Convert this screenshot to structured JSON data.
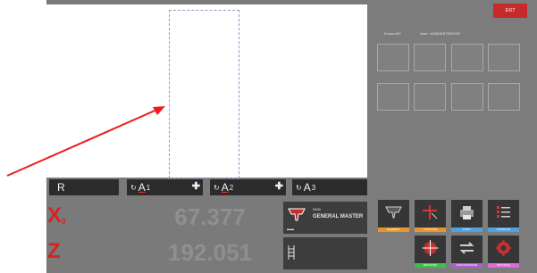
{
  "window": {
    "exit_label": "EXIT"
  },
  "status": {
    "left": "Erowa M2",
    "user": "User: ADMINISTRATOR"
  },
  "command_bar": {
    "r_label": "R",
    "a1": {
      "prefix": "↻",
      "letter": "A",
      "index": "1",
      "action": "✚"
    },
    "a2": {
      "prefix": "↻",
      "letter": "A",
      "index": "2",
      "action": "✚"
    },
    "a3": {
      "prefix": "↻",
      "letter": "A",
      "index": "3"
    }
  },
  "axes": {
    "x": {
      "letter": "X",
      "subscript": "0",
      "value": "67.377"
    },
    "z": {
      "letter": "Z",
      "value": "192.051"
    }
  },
  "tool": {
    "code": "0000",
    "name": "GENERAL MASTER",
    "status": "▬▬"
  },
  "functions": [
    {
      "label": "ELEMENT",
      "color": "#e8962b",
      "icon": "tool-holder-icon"
    },
    {
      "label": "FUNCTION",
      "color": "#e8962b",
      "icon": "crosshair-arrow-icon"
    },
    {
      "label": "PRINT",
      "color": "#4da3e0",
      "icon": "printer-icon"
    },
    {
      "label": "DATABASE",
      "color": "#4da3e0",
      "icon": "database-list-icon"
    },
    {
      "label": "METHODS",
      "color": "#3cc04a",
      "icon": "crosshair-target-icon"
    },
    {
      "label": "DATATRANSFER",
      "color": "#b35bd6",
      "icon": "transfer-arrows-icon"
    },
    {
      "label": "SETTINGS",
      "color": "#e06ad8",
      "icon": "gear-settings-icon"
    }
  ],
  "colors": {
    "accent_red": "#c62a2a",
    "panel_dark": "#2b2b2b",
    "background": "#7a7a7a"
  }
}
